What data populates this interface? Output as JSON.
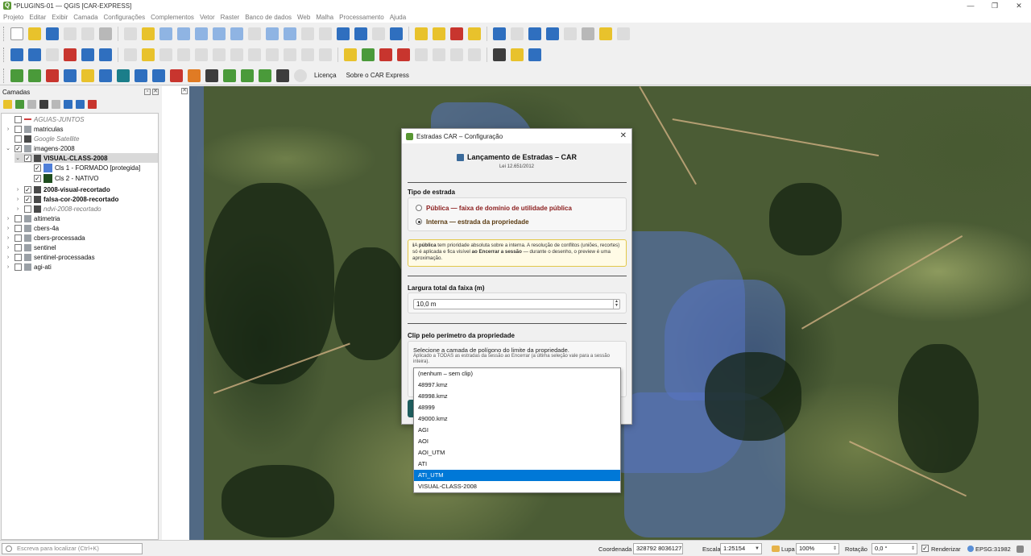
{
  "window": {
    "title": "*PLUGINS-01 — QGIS [CAR-EXPRESS]",
    "app_glyph": "Q",
    "minimize_glyph": "—",
    "restore_glyph": "❐",
    "close_glyph": "✕"
  },
  "menubar": [
    "Projeto",
    "Editar",
    "Exibir",
    "Camada",
    "Configurações",
    "Complementos",
    "Vetor",
    "Raster",
    "Banco de dados",
    "Web",
    "Malha",
    "Processamento",
    "Ajuda"
  ],
  "toolbar3": {
    "license_label": "Licença",
    "about_label": "Sobre o CAR Express"
  },
  "layers_panel": {
    "title": "Camadas",
    "float_glyph": "▫",
    "close_glyph": "✕",
    "items": [
      {
        "label": "AGUAS-JUNTOS",
        "checked": false,
        "expander": "",
        "style": "italic-grey",
        "icon_color": "#d04040"
      },
      {
        "label": "matriculas",
        "checked": false,
        "expander": "›",
        "style": "normal",
        "icon_color": "#9aa0a6"
      },
      {
        "label": "Google Satellite",
        "checked": false,
        "expander": "",
        "style": "italic-grey",
        "icon_color": "#4a4a4a"
      },
      {
        "label": "imagens-2008",
        "checked": true,
        "expander": "⌄",
        "style": "normal",
        "icon_color": "#9aa0a6"
      },
      {
        "label": "VISUAL-CLASS-2008",
        "checked": true,
        "expander": "⌄",
        "style": "bold",
        "icon_color": "#4a4a4a"
      },
      {
        "label": "Cls 1 - FORMADO [protegida]",
        "checked": true,
        "expander": "",
        "style": "normal",
        "icon_color": "#4f7fd8"
      },
      {
        "label": "Cls 2 - NATIVO",
        "checked": true,
        "expander": "",
        "style": "normal",
        "icon_color": "#1e4d1e"
      },
      {
        "label": "2008-visual-recortado",
        "checked": true,
        "expander": "›",
        "style": "bold",
        "icon_color": "#4a4a4a"
      },
      {
        "label": "falsa-cor-2008-recortado",
        "checked": true,
        "expander": "›",
        "style": "bold",
        "icon_color": "#4a4a4a"
      },
      {
        "label": "ndvi-2008-recortado",
        "checked": false,
        "expander": "›",
        "style": "italic-grey",
        "icon_color": "#4a4a4a"
      },
      {
        "label": "altimetria",
        "checked": false,
        "expander": "›",
        "style": "normal",
        "icon_color": "#9aa0a6"
      },
      {
        "label": "cbers-4a",
        "checked": false,
        "expander": "›",
        "style": "normal",
        "icon_color": "#9aa0a6"
      },
      {
        "label": "cbers-processada",
        "checked": false,
        "expander": "›",
        "style": "normal",
        "icon_color": "#9aa0a6"
      },
      {
        "label": "sentinel",
        "checked": false,
        "expander": "›",
        "style": "normal",
        "icon_color": "#9aa0a6"
      },
      {
        "label": "sentinel-processadas",
        "checked": false,
        "expander": "›",
        "style": "normal",
        "icon_color": "#9aa0a6"
      },
      {
        "label": "agi-ati",
        "checked": false,
        "expander": "›",
        "style": "normal",
        "icon_color": "#9aa0a6"
      }
    ]
  },
  "dialog": {
    "title": "Estradas CAR – Configuração",
    "close_glyph": "✕",
    "header": "Lançamento de Estradas – CAR",
    "subheader": "Lei 12.651/2012",
    "road_type": {
      "section": "Tipo de estrada",
      "public_label": "Pública — faixa de domínio de utilidade pública",
      "internal_label": "Interna — estrada da propriedade",
      "selected": "internal"
    },
    "note": {
      "lead": "A ",
      "bold1": "pública",
      "mid": " tem prioridade absoluta sobre a interna. A resolução de conflitos (uniões, recortes) só é aplicada e fica visível ",
      "bold2": "ao Encerrar a sessão",
      "tail": " — durante o desenho, o preview é uma aproximação."
    },
    "width": {
      "section": "Largura total da faixa (m)",
      "value": "10,0 m"
    },
    "clip": {
      "section": "Clip pelo perímetro da propriedade",
      "desc": "Selecione a camada de polígono do limite da propriedade.",
      "small": "Aplicado a TODAS as estradas da sessão ao Encerrar (a última seleção vale para a sessão inteira)."
    }
  },
  "dropdown": {
    "options": [
      "(nenhum – sem clip)",
      "48997.kmz",
      "48998.kmz",
      "48999",
      "49000.kmz",
      "AGI",
      "AOI",
      "AOI_UTM",
      "ATI",
      "ATI_UTM",
      "VISUAL-CLASS-2008"
    ],
    "selected": "ATI_UTM"
  },
  "statusbar": {
    "locator_placeholder": "Escreva para localizar (Ctrl+K)",
    "coord_label": "Coordenada",
    "coord_value": "328792  8036127",
    "scale_label": "Escala",
    "scale_value": "1:25154",
    "magnifier_label": "Lupa",
    "magnifier_value": "100%",
    "rotation_label": "Rotação",
    "rotation_value": "0,0 °",
    "render_label": "Renderizar",
    "render_checked": true,
    "crs": "EPSG:31982"
  }
}
